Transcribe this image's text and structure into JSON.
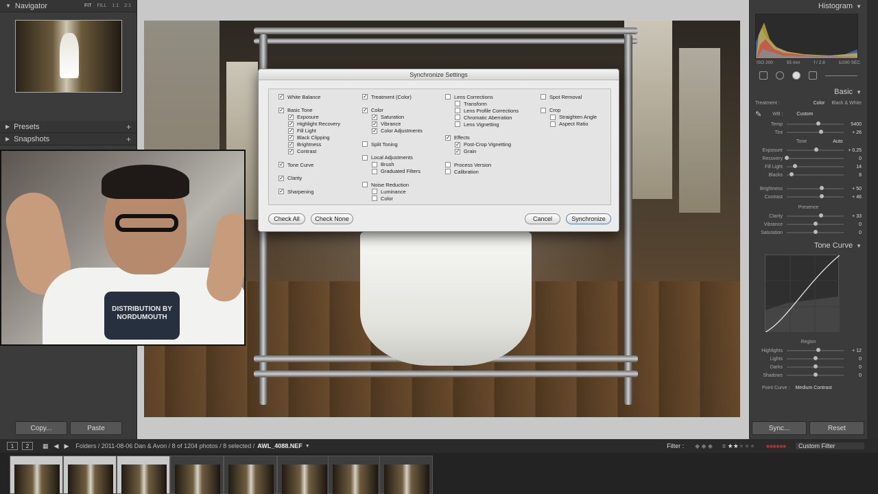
{
  "navigator": {
    "title": "Navigator",
    "options": [
      "FIT",
      "FILL",
      "1:1",
      "2:1"
    ]
  },
  "left_panel": {
    "presets": "Presets",
    "snapshots": "Snapshots",
    "copy_button": "Copy...",
    "paste_button": "Paste"
  },
  "webcam": {
    "shirt_text": "DISTRIBUTION BY NORDUMOUTH"
  },
  "dialog": {
    "title": "Synchronize Settings",
    "col1": [
      {
        "label": "White Balance",
        "checked": true,
        "sub": false
      },
      {
        "label": "gap"
      },
      {
        "label": "Basic Tone",
        "checked": true,
        "sub": false
      },
      {
        "label": "Exposure",
        "checked": true,
        "sub": true
      },
      {
        "label": "Highlight Recovery",
        "checked": true,
        "sub": true
      },
      {
        "label": "Fill Light",
        "checked": true,
        "sub": true
      },
      {
        "label": "Black Clipping",
        "checked": true,
        "sub": true
      },
      {
        "label": "Brightness",
        "checked": true,
        "sub": true
      },
      {
        "label": "Contrast",
        "checked": true,
        "sub": true
      },
      {
        "label": "gap"
      },
      {
        "label": "Tone Curve",
        "checked": true,
        "sub": false
      },
      {
        "label": "gap"
      },
      {
        "label": "Clarity",
        "checked": true,
        "sub": false
      },
      {
        "label": "gap"
      },
      {
        "label": "Sharpening",
        "checked": true,
        "sub": false
      }
    ],
    "col2": [
      {
        "label": "Treatment (Color)",
        "checked": true,
        "sub": false
      },
      {
        "label": "gap"
      },
      {
        "label": "Color",
        "checked": true,
        "sub": false
      },
      {
        "label": "Saturation",
        "checked": true,
        "sub": true
      },
      {
        "label": "Vibrance",
        "checked": true,
        "sub": true
      },
      {
        "label": "Color Adjustments",
        "checked": true,
        "sub": true
      },
      {
        "label": "gap"
      },
      {
        "label": "Split Toning",
        "checked": false,
        "sub": false
      },
      {
        "label": "gap"
      },
      {
        "label": "Local Adjustments",
        "checked": false,
        "sub": false
      },
      {
        "label": "Brush",
        "checked": false,
        "sub": true
      },
      {
        "label": "Graduated Filters",
        "checked": false,
        "sub": true
      },
      {
        "label": "gap"
      },
      {
        "label": "Noise Reduction",
        "checked": false,
        "sub": false
      },
      {
        "label": "Luminance",
        "checked": false,
        "sub": true
      },
      {
        "label": "Color",
        "checked": false,
        "sub": true
      }
    ],
    "col3": [
      {
        "label": "Lens Corrections",
        "checked": false,
        "sub": false
      },
      {
        "label": "Transform",
        "checked": false,
        "sub": true
      },
      {
        "label": "Lens Profile Corrections",
        "checked": false,
        "sub": true
      },
      {
        "label": "Chromatic Aberration",
        "checked": false,
        "sub": true
      },
      {
        "label": "Lens Vignetting",
        "checked": false,
        "sub": true
      },
      {
        "label": "gap"
      },
      {
        "label": "Effects",
        "checked": true,
        "sub": false
      },
      {
        "label": "Post-Crop Vignetting",
        "checked": true,
        "sub": true
      },
      {
        "label": "Grain",
        "checked": true,
        "sub": true
      },
      {
        "label": "gap"
      },
      {
        "label": "Process Version",
        "checked": false,
        "sub": false
      },
      {
        "label": "Calibration",
        "checked": false,
        "sub": false
      }
    ],
    "col4": [
      {
        "label": "Spot Removal",
        "checked": false,
        "sub": false
      },
      {
        "label": "gap"
      },
      {
        "label": "Crop",
        "checked": false,
        "sub": false
      },
      {
        "label": "Straighten Angle",
        "checked": false,
        "sub": true
      },
      {
        "label": "Aspect Ratio",
        "checked": false,
        "sub": true
      }
    ],
    "buttons": {
      "check_all": "Check All",
      "check_none": "Check None",
      "cancel": "Cancel",
      "synchronize": "Synchronize"
    }
  },
  "right_panel": {
    "histogram_title": "Histogram",
    "hist_info": [
      "ISO 200",
      "55 mm",
      "f / 2.8",
      "1/200 SEC"
    ],
    "basic_title": "Basic",
    "treatment_label": "Treatment :",
    "treatment_color": "Color",
    "treatment_bw": "Black & White",
    "wb_label": "WB :",
    "wb_value": "Custom",
    "temp": {
      "label": "Temp",
      "value": "5400",
      "level": 0.55
    },
    "tint": {
      "label": "Tint",
      "value": "+ 26",
      "level": 0.6
    },
    "tone_label": "Tone",
    "auto_label": "Auto",
    "tone_sliders": [
      {
        "label": "Exposure",
        "value": "+ 0.25",
        "level": 0.52
      },
      {
        "label": "Recovery",
        "value": "0",
        "level": 0.0
      },
      {
        "label": "Fill Light",
        "value": "14",
        "level": 0.14
      },
      {
        "label": "Blacks",
        "value": "8",
        "level": 0.08
      }
    ],
    "bright_sliders": [
      {
        "label": "Brightness",
        "value": "+ 50",
        "level": 0.62
      },
      {
        "label": "Contrast",
        "value": "+ 46",
        "level": 0.62
      }
    ],
    "presence_label": "Presence",
    "presence_sliders": [
      {
        "label": "Clarity",
        "value": "+ 33",
        "level": 0.6
      },
      {
        "label": "Vibrance",
        "value": "0",
        "level": 0.5
      },
      {
        "label": "Saturation",
        "value": "0",
        "level": 0.5
      }
    ],
    "tone_curve_title": "Tone Curve",
    "region_label": "Region",
    "region_sliders": [
      {
        "label": "Highlights",
        "value": "+ 12",
        "level": 0.56
      },
      {
        "label": "Lights",
        "value": "0",
        "level": 0.5
      },
      {
        "label": "Darks",
        "value": "0",
        "level": 0.5
      },
      {
        "label": "Shadows",
        "value": "0",
        "level": 0.5
      }
    ],
    "point_curve_label": "Point Curve :",
    "point_curve_value": "Medium Contrast",
    "sync_button": "Sync...",
    "reset_button": "Reset"
  },
  "film_bar": {
    "page1": "1",
    "page2": "2",
    "path": "Folders / 2011-08-06 Dan & Avon / 8 of 1204 photos / 8 selected /",
    "file": "AWL_4088.NEF",
    "filter_label": "Filter :",
    "custom_filter": "Custom Filter"
  }
}
